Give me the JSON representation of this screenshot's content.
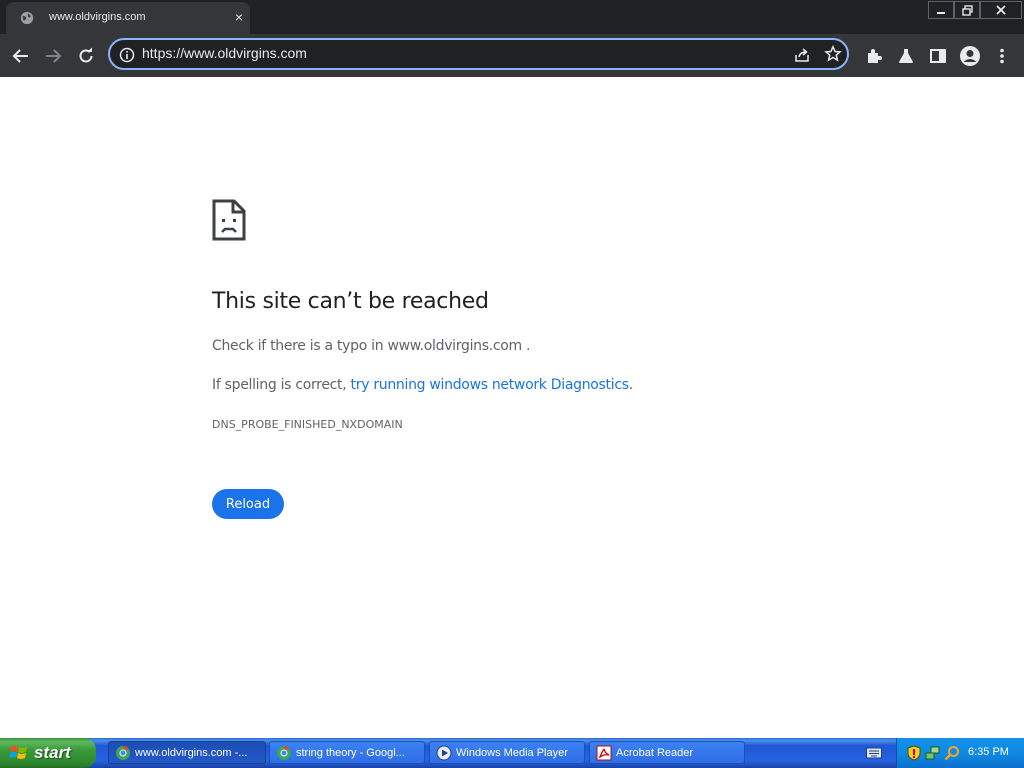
{
  "browser": {
    "tab": {
      "title": "www.oldvirgins.com",
      "close": "×"
    },
    "url": "https://www.oldvirgins.com"
  },
  "error_page": {
    "heading": "This site can’t be reached",
    "line1_prefix": "Check if there is a typo in ",
    "line1_host": "www.oldvirgins.com",
    "line1_suffix": " .",
    "line2_prefix": "If spelling is correct, ",
    "line2_link": "try running windows network Diagnostics",
    "line2_suffix": ".",
    "error_code": "DNS_PROBE_FINISHED_NXDOMAIN",
    "reload_label": "Reload"
  },
  "taskbar": {
    "start_label": "start",
    "items": [
      {
        "label": "www.oldvirgins.com -...",
        "icon": "chrome-icon"
      },
      {
        "label": "string theory - Googl...",
        "icon": "chrome-icon"
      },
      {
        "label": "Windows Media Player",
        "icon": "media-player-icon"
      },
      {
        "label": "Acrobat Reader",
        "icon": "acrobat-icon"
      }
    ],
    "clock": "6:35 PM"
  },
  "colors": {
    "accent": "#1a73e8",
    "omnibox_focus": "#8ab4f8",
    "toolbar_bg": "#35363a",
    "tabstrip_bg": "#202124"
  }
}
